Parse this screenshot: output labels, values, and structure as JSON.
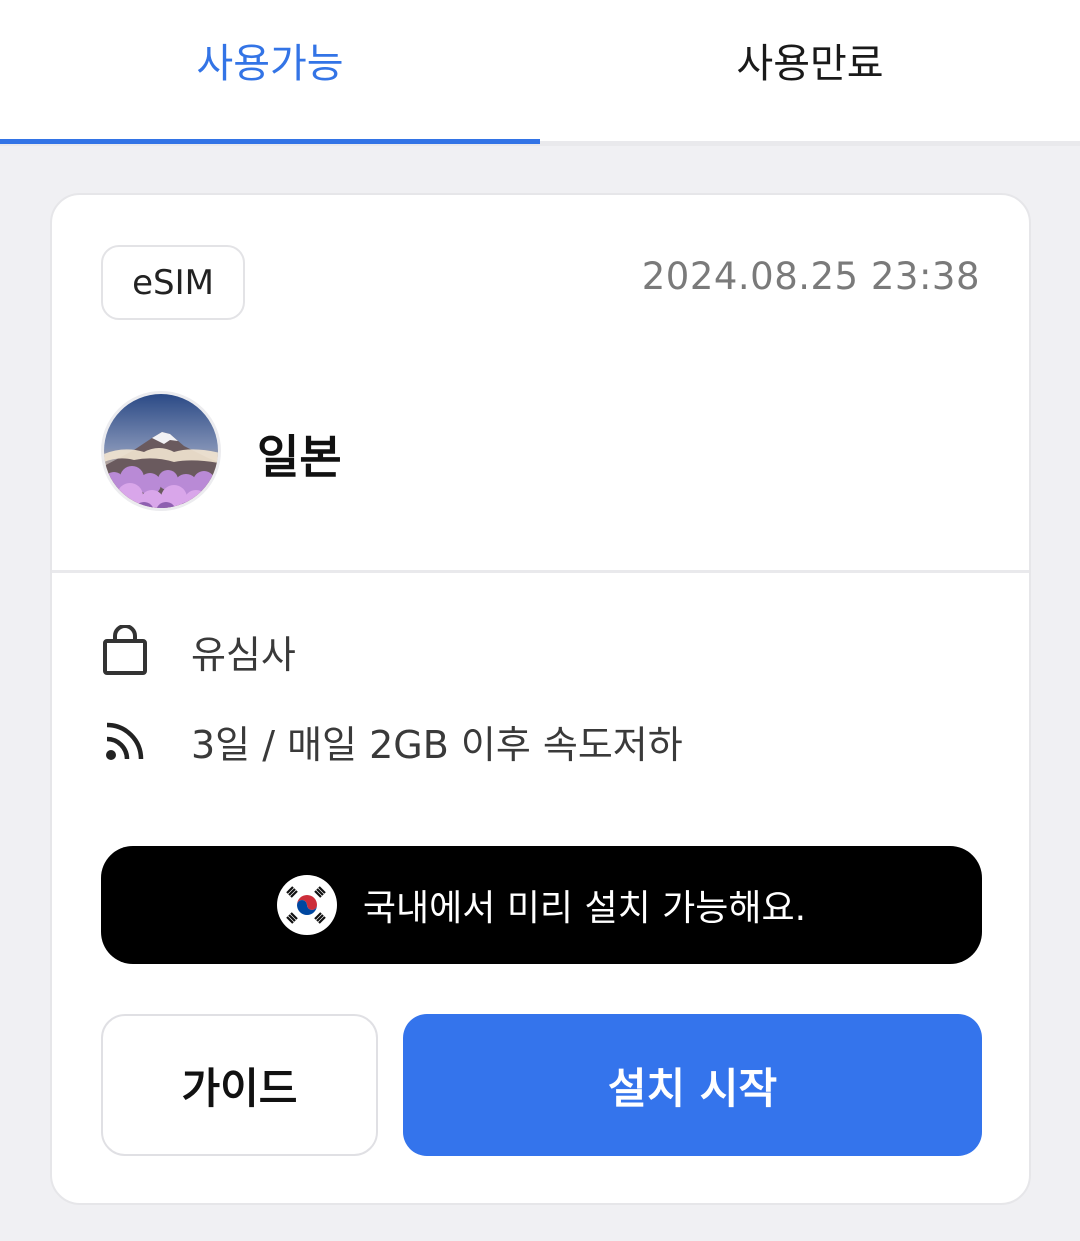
{
  "tabs": {
    "available": "사용가능",
    "expired": "사용만료",
    "active_color": "#3374e6"
  },
  "card": {
    "badge": "eSIM",
    "datetime": "2024.08.25 23:38",
    "country": "일본",
    "avatar_image": "mount-fuji-with-cherry-blossoms",
    "details": [
      {
        "icon": "shopping-bag-icon",
        "text": "유심사"
      },
      {
        "icon": "rss-signal-icon",
        "text": "3일 / 매일 2GB 이후 속도저하"
      }
    ],
    "banner": {
      "icon": "korea-flag-icon",
      "text": "국내에서 미리 설치 가능해요."
    },
    "buttons": {
      "guide": "가이드",
      "install": "설치 시작"
    }
  }
}
